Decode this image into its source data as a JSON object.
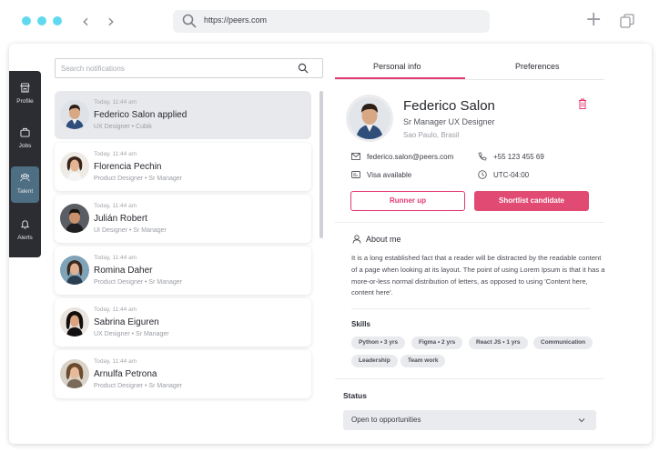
{
  "browser": {
    "url": "https://peers.com",
    "dot_color": "#60d9f0",
    "icons": [
      "back-arrow-icon",
      "forward-arrow-icon",
      "search-icon",
      "plus-icon",
      "tabs-icon"
    ]
  },
  "rail": {
    "items": [
      {
        "label": "Profile",
        "icon": "store-icon"
      },
      {
        "label": "Jobs",
        "icon": "briefcase-icon"
      },
      {
        "label": "Talent",
        "icon": "people-icon",
        "active": true
      },
      {
        "label": "Alerts",
        "icon": "bell-icon"
      }
    ]
  },
  "search": {
    "placeholder": "Search notifications"
  },
  "notifications": [
    {
      "time": "Today, 11:44 am",
      "name": "Federico Salon applied",
      "role": "UX Designer • Cubik",
      "active": true
    },
    {
      "time": "Today, 11:44 am",
      "name": "Florencia Pechin",
      "role": "Product Designer • Sr Manager"
    },
    {
      "time": "Today, 11:44 am",
      "name": "Julián Robert",
      "role": "UI Designer • Sr Manager"
    },
    {
      "time": "Today, 11:44 am",
      "name": "Romina Daher",
      "role": "Product Designer • Sr Manager"
    },
    {
      "time": "Today, 11:44 am",
      "name": "Sabrina Eiguren",
      "role": "UX Designer • Sr Manager"
    },
    {
      "time": "Today, 11:44 am",
      "name": "Arnulfa Petrona",
      "role": "Product Designer • Sr Manager"
    }
  ],
  "tabs": [
    {
      "label": "Personal info",
      "active": true
    },
    {
      "label": "Preferences"
    }
  ],
  "profile": {
    "name": "Federico Salon",
    "role": "Sr Manager UX Designer",
    "location": "Sao Paulo, Brasil",
    "email": "federico.salon@peers.com",
    "phone": "+55 123 455 69",
    "visa": "Visa available",
    "timezone": "UTC-04:00",
    "runner_up_label": "Runner up",
    "shortlist_label": "Shortlist candidate"
  },
  "about": {
    "title": "About me",
    "text": "It is a long established fact that a reader will be distracted by the readable content of a page when looking at its layout. The point of using Lorem Ipsum is that it has a more-or-less normal distribution of letters, as opposed to using 'Content here, content here'."
  },
  "skills": {
    "title": "Skills",
    "items": [
      "Python • 3 yrs",
      "Figma • 2 yrs",
      "React JS • 1 yrs",
      "Communication",
      "Leadership",
      "Team work"
    ]
  },
  "status": {
    "title": "Status",
    "value": "Open to opportunities"
  },
  "colors": {
    "accent": "#e5386e",
    "primary_button": "#e04a73",
    "rail_bg": "#2b2d33",
    "rail_active": "#4d6e83"
  }
}
